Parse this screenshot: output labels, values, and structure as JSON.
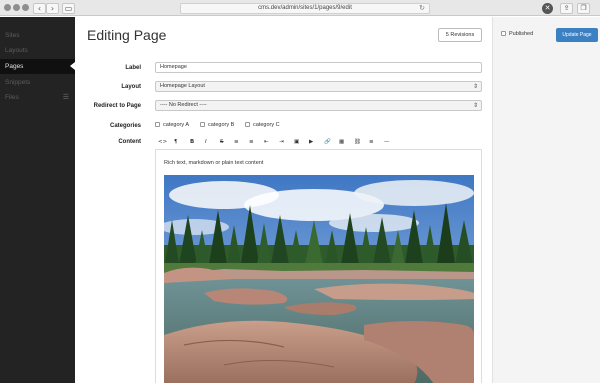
{
  "browser": {
    "url": "cms.dev/admin/sites/1/pages/9/edit",
    "back_icon": "chevron-left-icon",
    "forward_icon": "chevron-right-icon"
  },
  "sidebar": {
    "items": [
      {
        "label": "Sites",
        "active": false
      },
      {
        "label": "Layouts",
        "active": false
      },
      {
        "label": "Pages",
        "active": true
      },
      {
        "label": "Snippets",
        "active": false
      },
      {
        "label": "Files",
        "active": false
      }
    ]
  },
  "page": {
    "title": "Editing Page",
    "revisions_label": "5 Revisions"
  },
  "form": {
    "label_label": "Label",
    "label_value": "Homepage",
    "layout_label": "Layout",
    "layout_value": "Homepage Layout",
    "redirect_label": "Redirect to Page",
    "redirect_value": "---- No Redirect ----",
    "categories_label": "Categories",
    "categories": [
      "category A",
      "category B",
      "category C"
    ],
    "content_label": "Content"
  },
  "editor": {
    "toolbar": [
      "<>",
      "¶",
      "B",
      "I",
      "S",
      "≡",
      "≡",
      "⇤",
      "⇥",
      "▣",
      "▶",
      "🔗",
      "▦",
      "⛓",
      "≡",
      "—"
    ],
    "text": "Rich text, markdown or plain text content"
  },
  "right_panel": {
    "published_label": "Published",
    "update_label": "Update Page"
  },
  "colors": {
    "sidebar_bg": "#232323",
    "accent": "#3b80c3"
  }
}
